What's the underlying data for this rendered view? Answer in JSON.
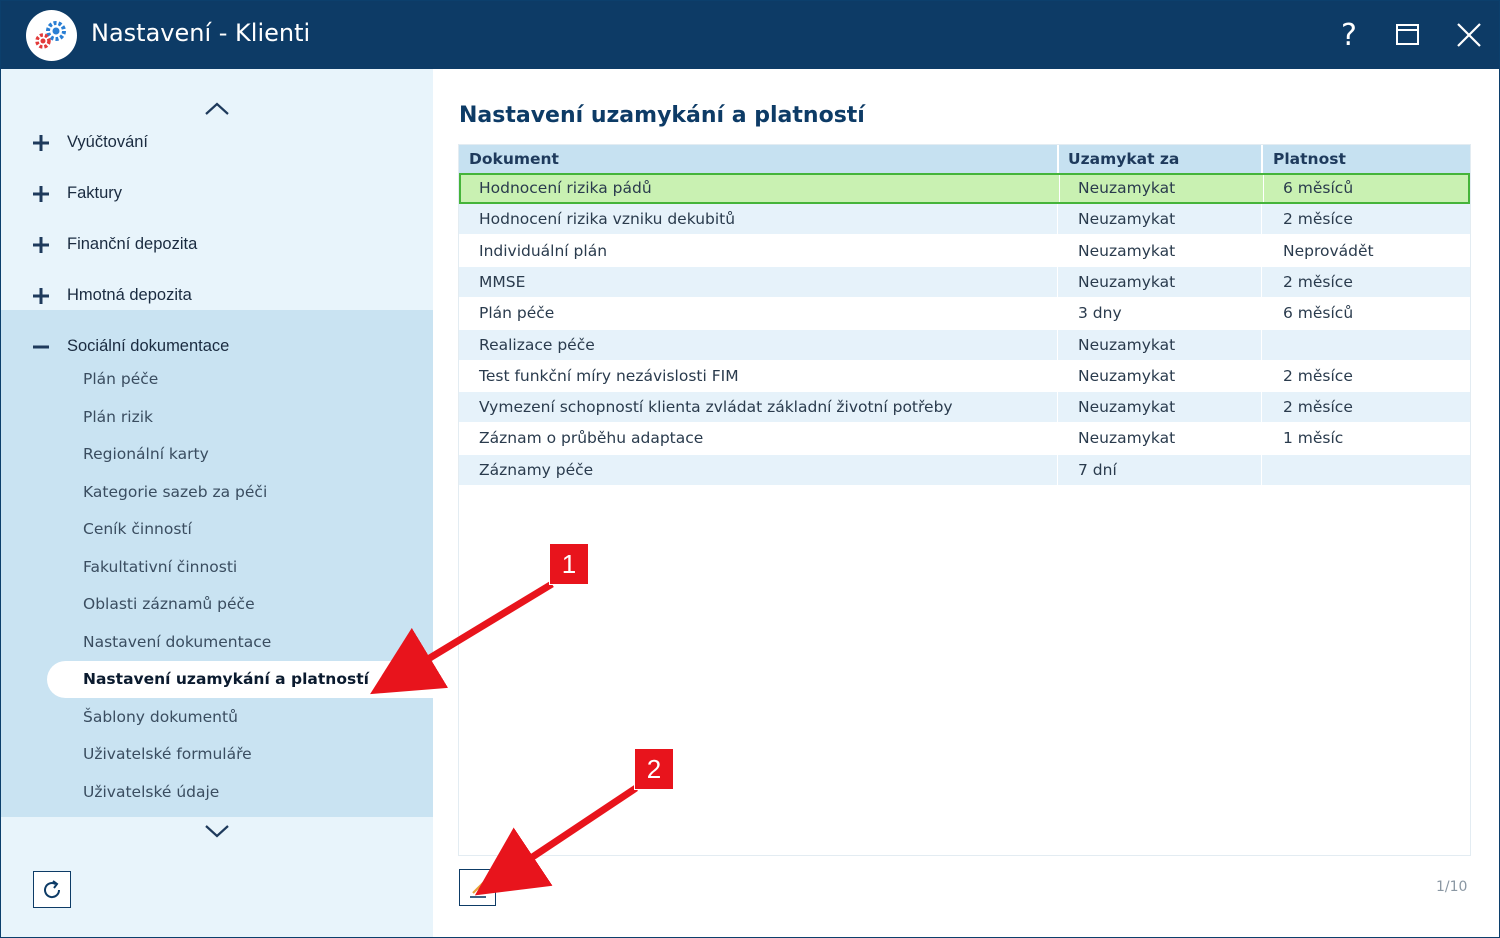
{
  "window": {
    "title": "Nastavení - Klienti",
    "help_label": "?",
    "icons": [
      "app-gears-icon",
      "help-icon",
      "maximize-icon",
      "close-icon"
    ]
  },
  "sidebar": {
    "top_items": [
      {
        "label": "Vyúčtování",
        "expanded": false
      },
      {
        "label": "Faktury",
        "expanded": false
      },
      {
        "label": "Finanční depozita",
        "expanded": false
      },
      {
        "label": "Hmotná depozita",
        "expanded": false
      },
      {
        "label": "Sociální dokumentace",
        "expanded": true
      }
    ],
    "sub_items": [
      "Plán péče",
      "Plán rizik",
      "Regionální karty",
      "Kategorie sazeb za péči",
      "Ceník činností",
      "Fakultativní činnosti",
      "Oblasti záznamů péče",
      "Nastavení dokumentace",
      "Nastavení uzamykání a platností",
      "Šablony dokumentů",
      "Uživatelské formuláře",
      "Uživatelské údaje"
    ],
    "active_sub_item": "Nastavení uzamykání a platností"
  },
  "main": {
    "heading": "Nastavení uzamykání a platností",
    "columns": [
      "Dokument",
      "Uzamykat za",
      "Platnost"
    ],
    "rows": [
      [
        "Hodnocení rizika pádů",
        "Neuzamykat",
        "6 měsíců"
      ],
      [
        "Hodnocení rizika vzniku dekubitů",
        "Neuzamykat",
        "2 měsíce"
      ],
      [
        "Individuální plán",
        "Neuzamykat",
        "Neprovádět"
      ],
      [
        "MMSE",
        "Neuzamykat",
        "2 měsíce"
      ],
      [
        "Plán péče",
        "3 dny",
        "6 měsíců"
      ],
      [
        "Realizace péče",
        "Neuzamykat",
        ""
      ],
      [
        "Test funkční míry nezávislosti FIM",
        "Neuzamykat",
        "2 měsíce"
      ],
      [
        "Vymezení schopností klienta zvládat základní životní potřeby",
        "Neuzamykat",
        "2 měsíce"
      ],
      [
        "Záznam o průběhu adaptace",
        "Neuzamykat",
        "1 měsíc"
      ],
      [
        "Záznamy péče",
        "7 dní",
        ""
      ]
    ],
    "selected_row": 0,
    "pager": "1/10"
  },
  "annotations": {
    "callout_1": "1",
    "callout_2": "2"
  },
  "colors": {
    "titlebar": "#0d3b66",
    "sidebar": "#e8f4fb",
    "sidebar_section": "#c9e3f2",
    "header_row": "#c6e1f1",
    "selected_row": "#c9f1b2",
    "selected_border": "#45b43a",
    "callout": "#e8141c"
  }
}
